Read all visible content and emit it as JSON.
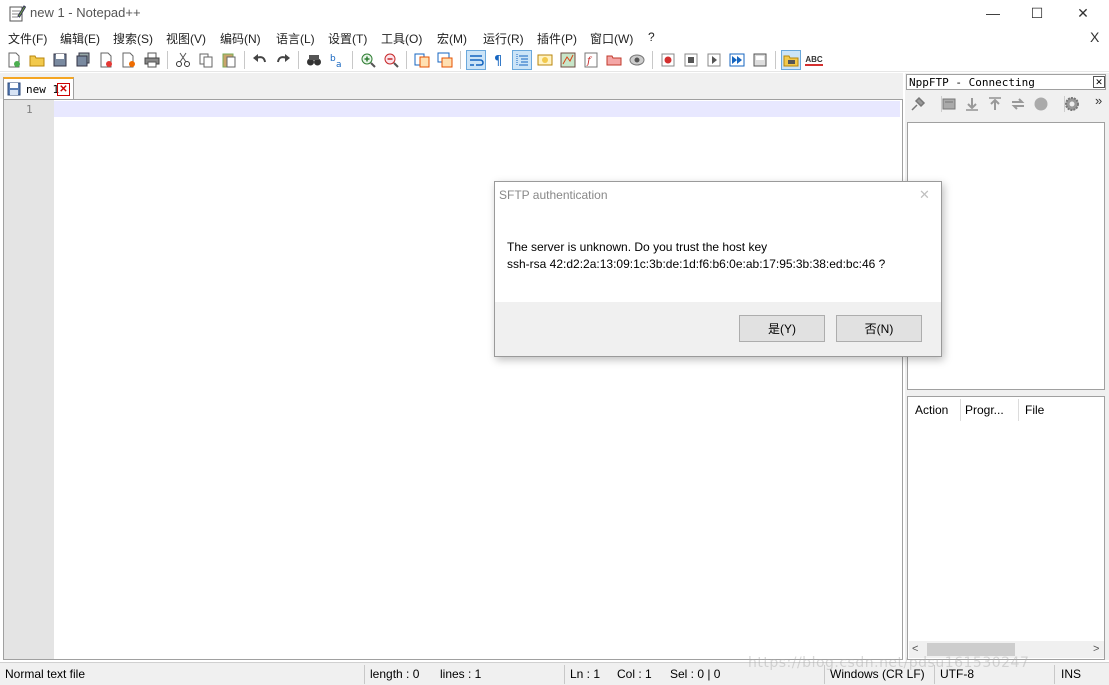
{
  "window": {
    "title": "new 1 - Notepad++",
    "minimize_glyph": "—",
    "maximize_glyph": "☐",
    "close_glyph": "✕"
  },
  "menu": {
    "items": [
      "文件(F)",
      "编辑(E)",
      "搜索(S)",
      "视图(V)",
      "编码(N)",
      "语言(L)",
      "设置(T)",
      "工具(O)",
      "宏(M)",
      "运行(R)",
      "插件(P)",
      "窗口(W)",
      "?"
    ],
    "close_doc": "X"
  },
  "toolbar": {
    "spellcheck_label": "ABC"
  },
  "tabs": [
    {
      "label": "new 1",
      "close": "✕"
    }
  ],
  "editor": {
    "line_number": "1"
  },
  "ftp_panel": {
    "title": "NppFTP - Connecting",
    "close": "✕",
    "more": "»",
    "queue_columns": [
      "Action",
      "Progr...",
      "File"
    ],
    "scroll_left": "<",
    "scroll_right": ">"
  },
  "statusbar": {
    "file_type": "Normal text file",
    "length": "length : 0",
    "lines": "lines : 1",
    "ln": "Ln : 1",
    "col": "Col : 1",
    "sel": "Sel : 0 | 0",
    "eol": "Windows (CR LF)",
    "encoding": "UTF-8",
    "mode": "INS"
  },
  "watermark": "https://blog.csdn.net/pdsu161530247",
  "dialog": {
    "title": "SFTP authentication",
    "close": "✕",
    "message_line1": "The server is unknown. Do you trust the host key",
    "message_line2": "ssh-rsa 42:d2:2a:13:09:1c:3b:de:1d:f6:b6:0e:ab:17:95:3b:38:ed:bc:46 ?",
    "yes_label": "是(Y)",
    "no_label": "否(N)"
  },
  "colors": {
    "current_line": "#e8e8ff",
    "gutter": "#e4e4e4",
    "tab_accent": "#f5a623",
    "toolbar_active": "#cce4f7"
  }
}
